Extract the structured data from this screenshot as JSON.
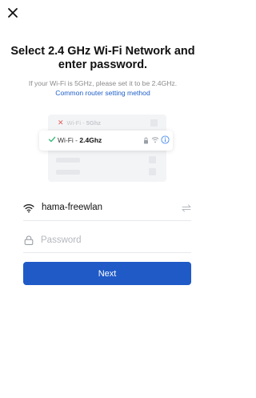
{
  "header": {
    "close_icon": "close-icon"
  },
  "title": {
    "line1": "Select 2.4 GHz Wi-Fi Network and",
    "line2": "enter password."
  },
  "hint": "If your Wi-Fi is 5GHz, please set it to be 2.4GHz.",
  "link": "Common router setting method",
  "illustration": {
    "row_5g": {
      "prefix": "Wi-Fi - ",
      "band": "5Ghz"
    },
    "row_24g": {
      "prefix": "Wi-Fi - ",
      "band": "2.4Ghz"
    }
  },
  "wifi_field": {
    "value": "hama-freewlan",
    "lead_icon": "wifi-icon",
    "trail_icon": "swap-icon"
  },
  "password_field": {
    "placeholder": "Password",
    "lead_icon": "lock-icon"
  },
  "next_label": "Next",
  "colors": {
    "accent": "#1f5ac7",
    "link": "#1f5fc9",
    "check": "#2bb673",
    "x_mark": "#e15a5a"
  }
}
